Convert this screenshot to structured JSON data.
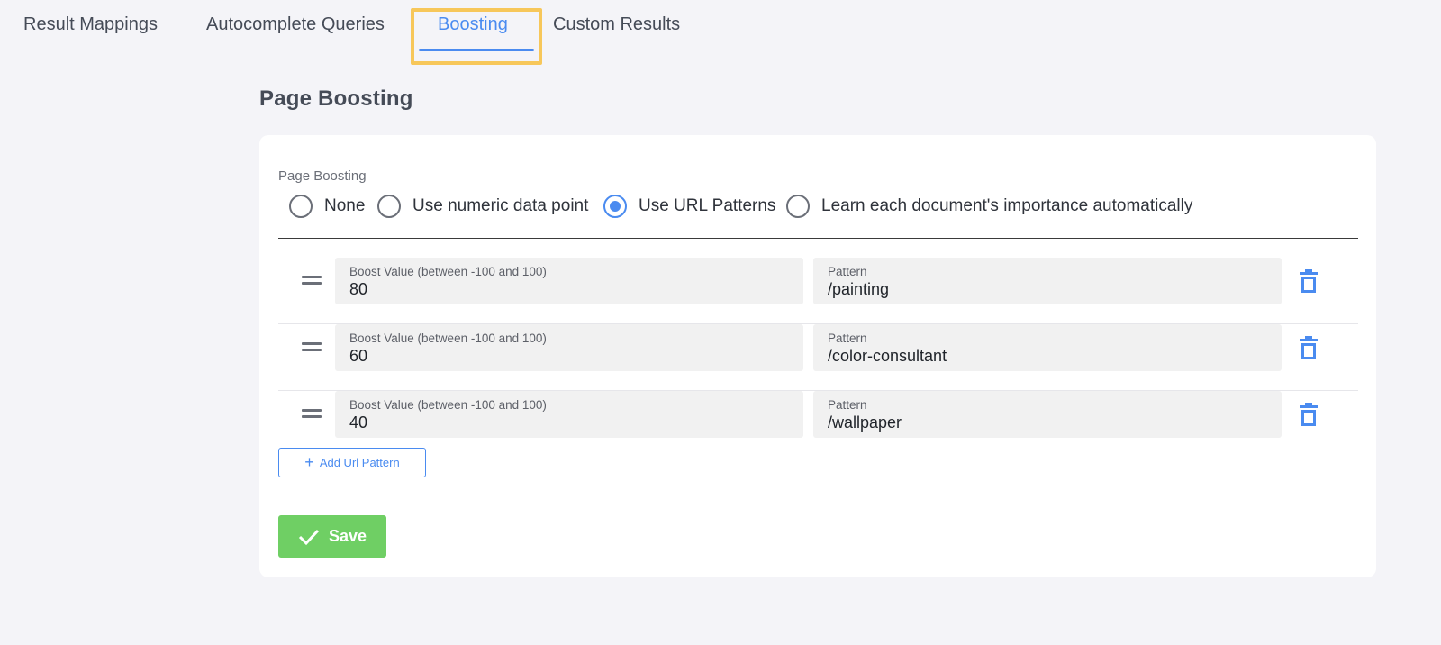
{
  "tabs": [
    {
      "label": "Result Mappings",
      "active": false
    },
    {
      "label": "Autocomplete Queries",
      "active": false
    },
    {
      "label": "Boosting",
      "active": true
    },
    {
      "label": "Custom Results",
      "active": false
    }
  ],
  "page_title": "Page Boosting",
  "boosting": {
    "field_label": "Page Boosting",
    "selected": "Use URL Patterns",
    "options": [
      "None",
      "Use numeric data point",
      "Use URL Patterns",
      "Learn each document's importance automatically"
    ]
  },
  "rows": [
    {
      "boost_label": "Boost Value (between -100 and 100)",
      "boost_value": "80",
      "pattern_label": "Pattern",
      "pattern_value": "/painting"
    },
    {
      "boost_label": "Boost Value (between -100 and 100)",
      "boost_value": "60",
      "pattern_label": "Pattern",
      "pattern_value": "/color-consultant"
    },
    {
      "boost_label": "Boost Value (between -100 and 100)",
      "boost_value": "40",
      "pattern_label": "Pattern",
      "pattern_value": "/wallpaper"
    }
  ],
  "add_button": {
    "icon": "plus-icon",
    "label": "Add Url Pattern"
  },
  "save_button": {
    "icon": "check-icon",
    "label": "Save"
  },
  "colors": {
    "accent": "#4a8bf0",
    "save": "#6fcf64",
    "tab_highlight": "#f7c75a"
  }
}
